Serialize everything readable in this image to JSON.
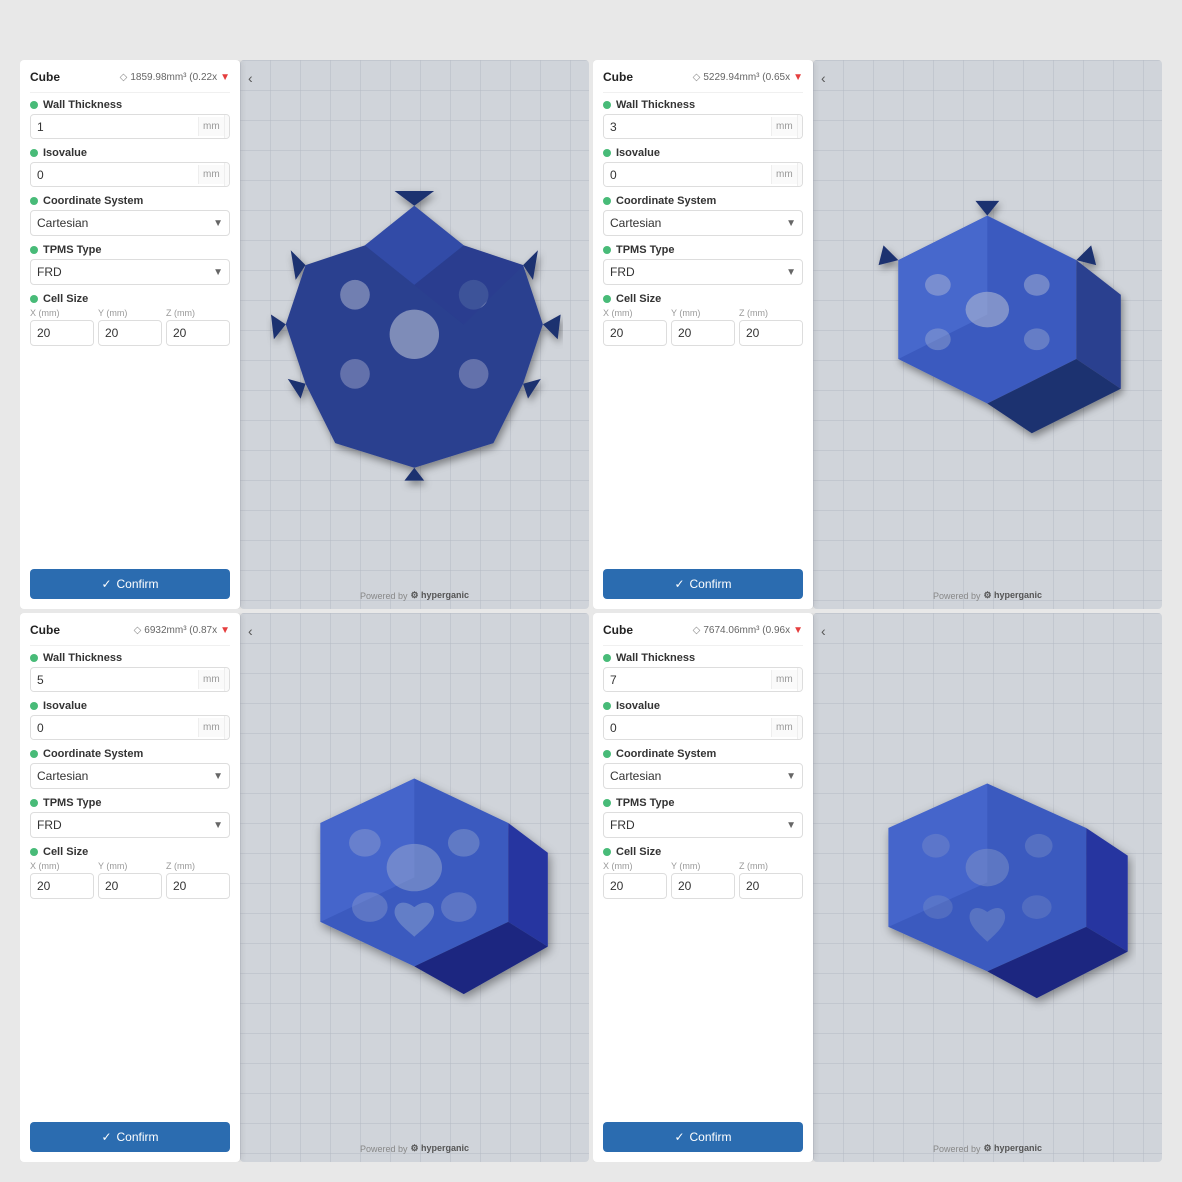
{
  "panels": [
    {
      "id": "panel-1",
      "title": "Cube",
      "volume": "1859.98mm³ (0.22x",
      "wall_thickness": "1",
      "isovalue": "0",
      "coordinate_system": "Cartesian",
      "tpms_type": "FRD",
      "cell_x": "20",
      "cell_y": "20",
      "cell_z": "20",
      "shape_type": "spiky"
    },
    {
      "id": "panel-2",
      "title": "Cube",
      "volume": "5229.94mm³ (0.65x",
      "wall_thickness": "3",
      "isovalue": "0",
      "coordinate_system": "Cartesian",
      "tpms_type": "FRD",
      "cell_x": "20",
      "cell_y": "20",
      "cell_z": "20",
      "shape_type": "medium"
    },
    {
      "id": "panel-3",
      "title": "Cube",
      "volume": "6932mm³ (0.87x",
      "wall_thickness": "5",
      "isovalue": "0",
      "coordinate_system": "Cartesian",
      "tpms_type": "FRD",
      "cell_x": "20",
      "cell_y": "20",
      "cell_z": "20",
      "shape_type": "thick"
    },
    {
      "id": "panel-4",
      "title": "Cube",
      "volume": "7674.06mm³ (0.96x",
      "wall_thickness": "7",
      "isovalue": "0",
      "coordinate_system": "Cartesian",
      "tpms_type": "FRD",
      "cell_x": "20",
      "cell_y": "20",
      "cell_z": "20",
      "shape_type": "blockier"
    }
  ],
  "labels": {
    "wall_thickness": "Wall Thickness",
    "isovalue": "Isovalue",
    "coordinate_system": "Coordinate System",
    "tpms_type": "TPMS Type",
    "cell_size": "Cell Size",
    "x_mm": "X (mm)",
    "y_mm": "Y (mm)",
    "z_mm": "Z (mm)",
    "mm": "mm",
    "confirm": "Confirm",
    "powered_by": "Powered by",
    "hyperganic": "hyperganic",
    "cartesian": "Cartesian",
    "frd": "FRD"
  },
  "colors": {
    "green_dot": "#48bb78",
    "confirm_btn": "#2b6cb0",
    "shape_fill": "#2a3f8f",
    "volume_down": "#e53e3e"
  }
}
